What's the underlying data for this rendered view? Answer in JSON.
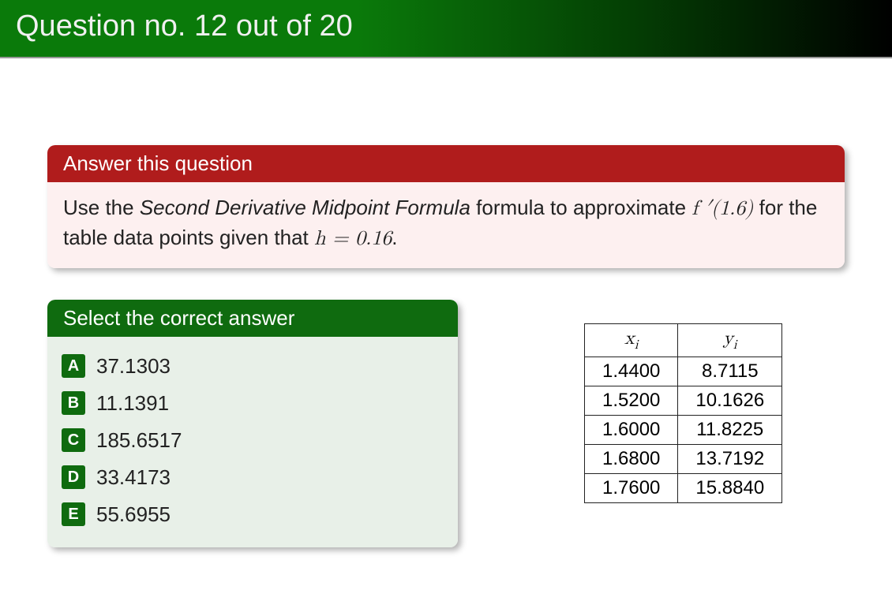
{
  "header": {
    "title": "Question no. 12 out of 20"
  },
  "question": {
    "heading": "Answer this question",
    "text_prefix": "Use the ",
    "formula_name": "Second Derivative Midpoint Formula",
    "text_mid": " formula to approximate ",
    "fprime": "f ′(1.6)",
    "text_suffix": " for the table data points given that ",
    "h_expr": "h = 0.16",
    "dot": "."
  },
  "answers": {
    "heading": "Select the correct answer",
    "options": [
      {
        "letter": "A",
        "value": "37.1303"
      },
      {
        "letter": "B",
        "value": "11.1391"
      },
      {
        "letter": "C",
        "value": "185.6517"
      },
      {
        "letter": "D",
        "value": "33.4173"
      },
      {
        "letter": "E",
        "value": "55.6955"
      }
    ]
  },
  "table": {
    "headers": {
      "x": "x",
      "xi": "i",
      "y": "y",
      "yi": "i"
    },
    "rows": [
      {
        "x": "1.4400",
        "y": "8.7115"
      },
      {
        "x": "1.5200",
        "y": "10.1626"
      },
      {
        "x": "1.6000",
        "y": "11.8225"
      },
      {
        "x": "1.6800",
        "y": "13.7192"
      },
      {
        "x": "1.7600",
        "y": "15.8840"
      }
    ]
  }
}
